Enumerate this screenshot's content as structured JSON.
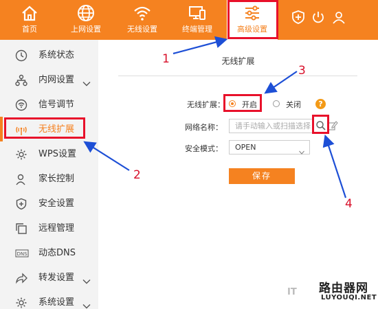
{
  "nav": {
    "items": [
      {
        "label": "首页",
        "icon": "home-icon"
      },
      {
        "label": "上网设置",
        "icon": "globe-icon"
      },
      {
        "label": "无线设置",
        "icon": "wifi-icon"
      },
      {
        "label": "终端管理",
        "icon": "devices-icon"
      },
      {
        "label": "高级设置",
        "icon": "sliders-icon"
      }
    ],
    "tools": [
      "shield-plus-icon",
      "power-icon",
      "user-icon"
    ]
  },
  "sidebar": {
    "items": [
      {
        "label": "系统状态",
        "icon": "clock-icon"
      },
      {
        "label": "内网设置",
        "icon": "network-icon"
      },
      {
        "label": "信号调节",
        "icon": "signal-icon"
      },
      {
        "label": "无线扩展",
        "icon": "wireless-extend-icon"
      },
      {
        "label": "WPS设置",
        "icon": "gear-icon"
      },
      {
        "label": "家长控制",
        "icon": "person-icon"
      },
      {
        "label": "安全设置",
        "icon": "shield-plus-icon"
      },
      {
        "label": "远程管理",
        "icon": "remote-icon"
      },
      {
        "label": "动态DNS",
        "icon": "dns-icon"
      },
      {
        "label": "转发设置",
        "icon": "forward-icon"
      },
      {
        "label": "系统设置",
        "icon": "gear-icon"
      }
    ]
  },
  "main": {
    "title": "无线扩展",
    "wireless_extend_label": "无线扩展：",
    "option_on": "开启",
    "option_off": "关闭",
    "help": "?",
    "network_name_label": "网络名称：",
    "network_name_placeholder": "请手动输入或扫描选择",
    "security_mode_label": "安全模式：",
    "security_mode_value": "OPEN",
    "save_label": "保存"
  },
  "annotations": {
    "numbers": [
      "1",
      "2",
      "3",
      "4"
    ]
  },
  "watermark": {
    "title": "路由器网",
    "url": "LUYOUQI.NET",
    "faded": "IT"
  },
  "colors": {
    "brand": "#f58220",
    "annotation_red": "#e8102a",
    "annotation_arrow": "#1d4fd6",
    "help_orange": "#f39a17"
  }
}
